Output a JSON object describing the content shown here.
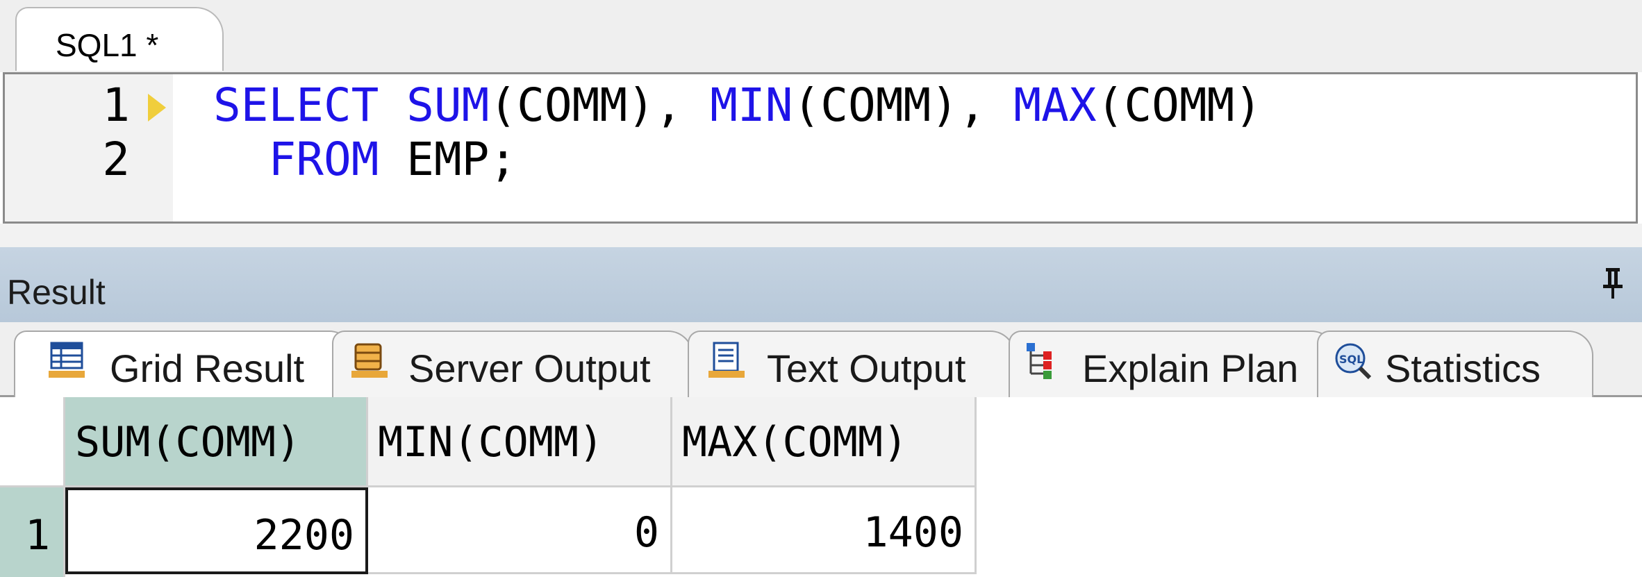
{
  "editor": {
    "tab_label": "SQL1 *",
    "line_numbers": [
      "1",
      "2"
    ],
    "lines": [
      [
        {
          "t": "SELECT",
          "k": true
        },
        {
          "t": " ",
          "k": false
        },
        {
          "t": "SUM",
          "k": true
        },
        {
          "t": "(COMM), ",
          "k": false
        },
        {
          "t": "MIN",
          "k": true
        },
        {
          "t": "(COMM), ",
          "k": false
        },
        {
          "t": "MAX",
          "k": true
        },
        {
          "t": "(COMM)",
          "k": false
        }
      ],
      [
        {
          "t": "  ",
          "k": false
        },
        {
          "t": "FROM",
          "k": true
        },
        {
          "t": " EMP;",
          "k": false
        }
      ]
    ],
    "keyword_color": "#1e13e8"
  },
  "result": {
    "title": "Result",
    "tabs": [
      {
        "label": "Grid Result",
        "icon": "grid-icon"
      },
      {
        "label": "Server Output",
        "icon": "database-icon"
      },
      {
        "label": "Text Output",
        "icon": "document-icon"
      },
      {
        "label": "Explain Plan",
        "icon": "tree-icon"
      },
      {
        "label": "Statistics",
        "icon": "sql-magnifier-icon"
      }
    ],
    "grid": {
      "columns": [
        "SUM(COMM)",
        "MIN(COMM)",
        "MAX(COMM)"
      ],
      "rows": [
        {
          "row_num": "1",
          "cells": [
            "2200",
            "0",
            "1400"
          ]
        }
      ]
    },
    "selection_color": "#b8d4cc"
  }
}
